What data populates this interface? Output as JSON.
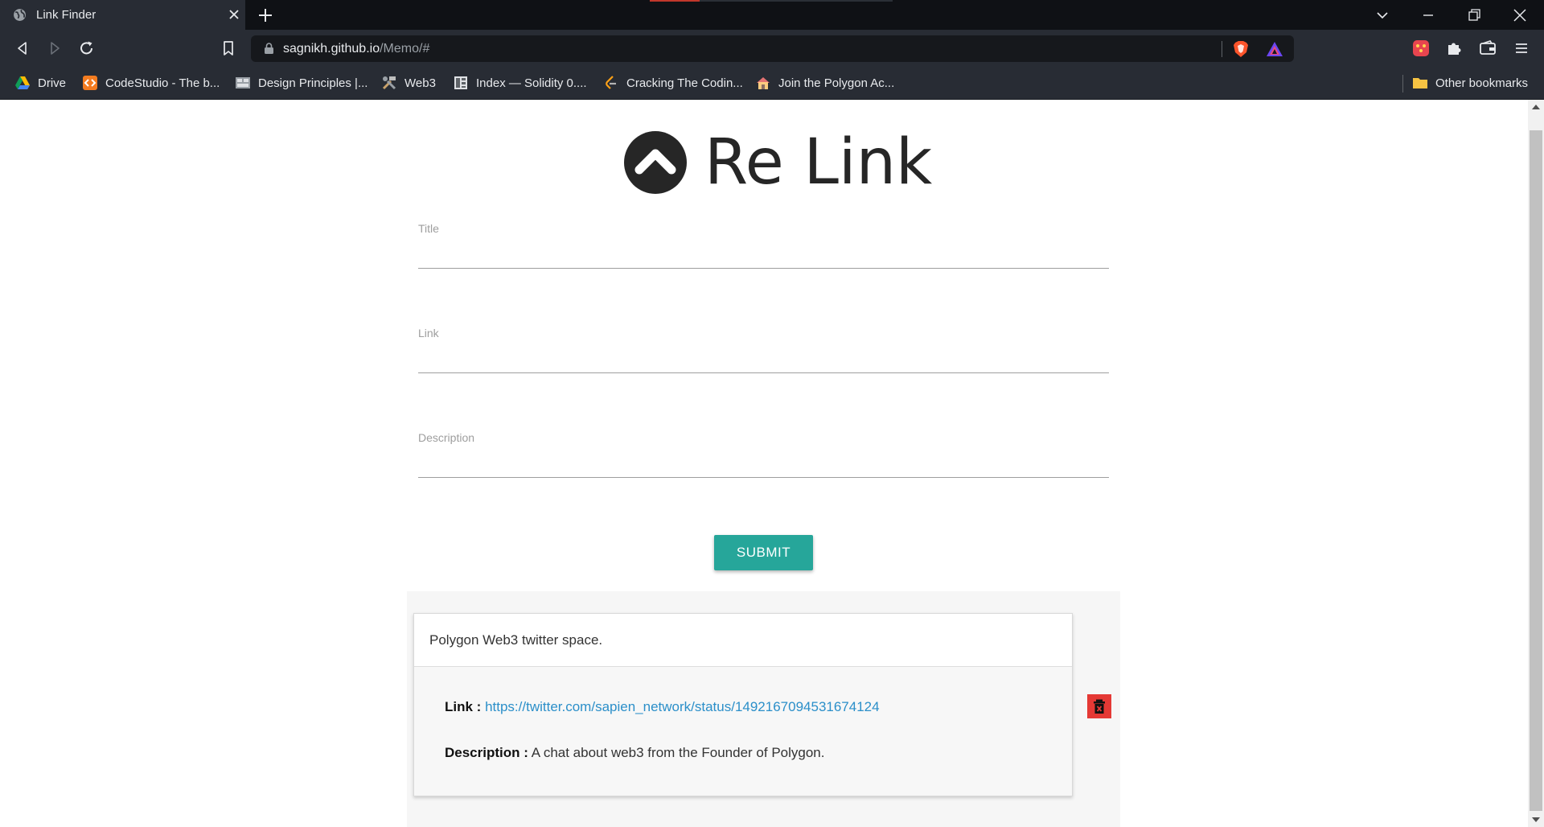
{
  "browser": {
    "tab_title": "Link Finder",
    "url_host": "sagnikh.github.io",
    "url_path": "/Memo/#",
    "bookmarks": [
      {
        "label": "Drive",
        "icon": "google-drive-icon"
      },
      {
        "label": "CodeStudio - The b...",
        "icon": "codestudio-icon"
      },
      {
        "label": "Design Principles |...",
        "icon": "design-principles-icon"
      },
      {
        "label": "Web3",
        "icon": "tools-icon"
      },
      {
        "label": "Index — Solidity 0....",
        "icon": "solidity-icon"
      },
      {
        "label": "Cracking The Codin...",
        "icon": "leetcode-icon"
      },
      {
        "label": "Join the Polygon Ac...",
        "icon": "house-icon"
      }
    ],
    "other_bookmarks": "Other bookmarks"
  },
  "app": {
    "brand": "Re Link",
    "fields": {
      "title_label": "Title",
      "link_label": "Link",
      "description_label": "Description"
    },
    "submit_label": "SUBMIT",
    "entries": [
      {
        "title": "Polygon Web3 twitter space.",
        "link_label": "Link :",
        "link": "https://twitter.com/sapien_network/status/1492167094531674124",
        "description_label": "Description :",
        "description": "A chat about web3 from the Founder of Polygon."
      }
    ]
  },
  "colors": {
    "accent": "#26a69a",
    "delete": "#e53935",
    "link": "#2b8fc9"
  }
}
